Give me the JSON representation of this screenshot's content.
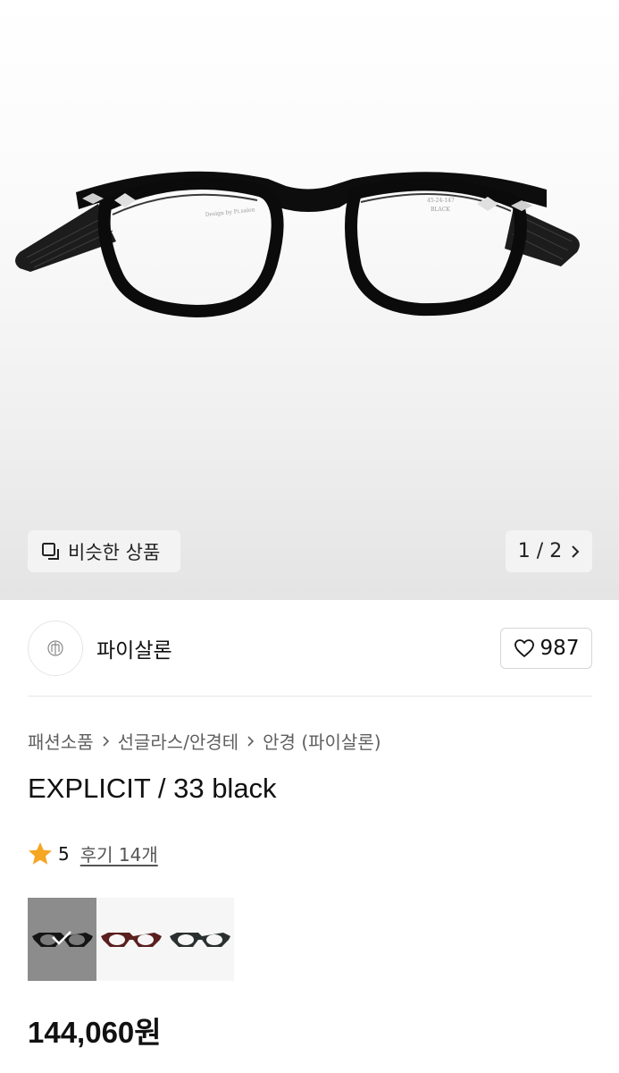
{
  "hero": {
    "product_image": "black-eyeglasses-frame",
    "frame_text_left": "Design by Pi.salon",
    "frame_text_model": "45-24-147",
    "frame_text_color": "BLACK",
    "similar_button_label": "비슷한 상품",
    "similar_icon": "copy-squares-icon",
    "pager": "1 / 2",
    "pager_icon": "chevron-right-icon"
  },
  "store": {
    "logo_icon": "store-logo-icon",
    "name": "파이살론",
    "like_icon": "heart-icon",
    "like_count": "987"
  },
  "breadcrumb": [
    "패션소품",
    "선글라스/안경테",
    "안경 (파이살론)"
  ],
  "product": {
    "title": "EXPLICIT / 33 black",
    "rating_icon": "star-icon",
    "rating": "5",
    "review_link": "후기 14개",
    "price": "144,060원"
  },
  "variants": [
    {
      "name": "black",
      "color": "#1a1a1a",
      "selected": true
    },
    {
      "name": "brown",
      "color": "#5a1f1f",
      "selected": false
    },
    {
      "name": "dark-green",
      "color": "#2a3030",
      "selected": false
    }
  ],
  "colors": {
    "star": "#f5a623",
    "text_primary": "#111111",
    "text_secondary": "#5f5f5f",
    "chip_bg": "#f3f3f3"
  }
}
